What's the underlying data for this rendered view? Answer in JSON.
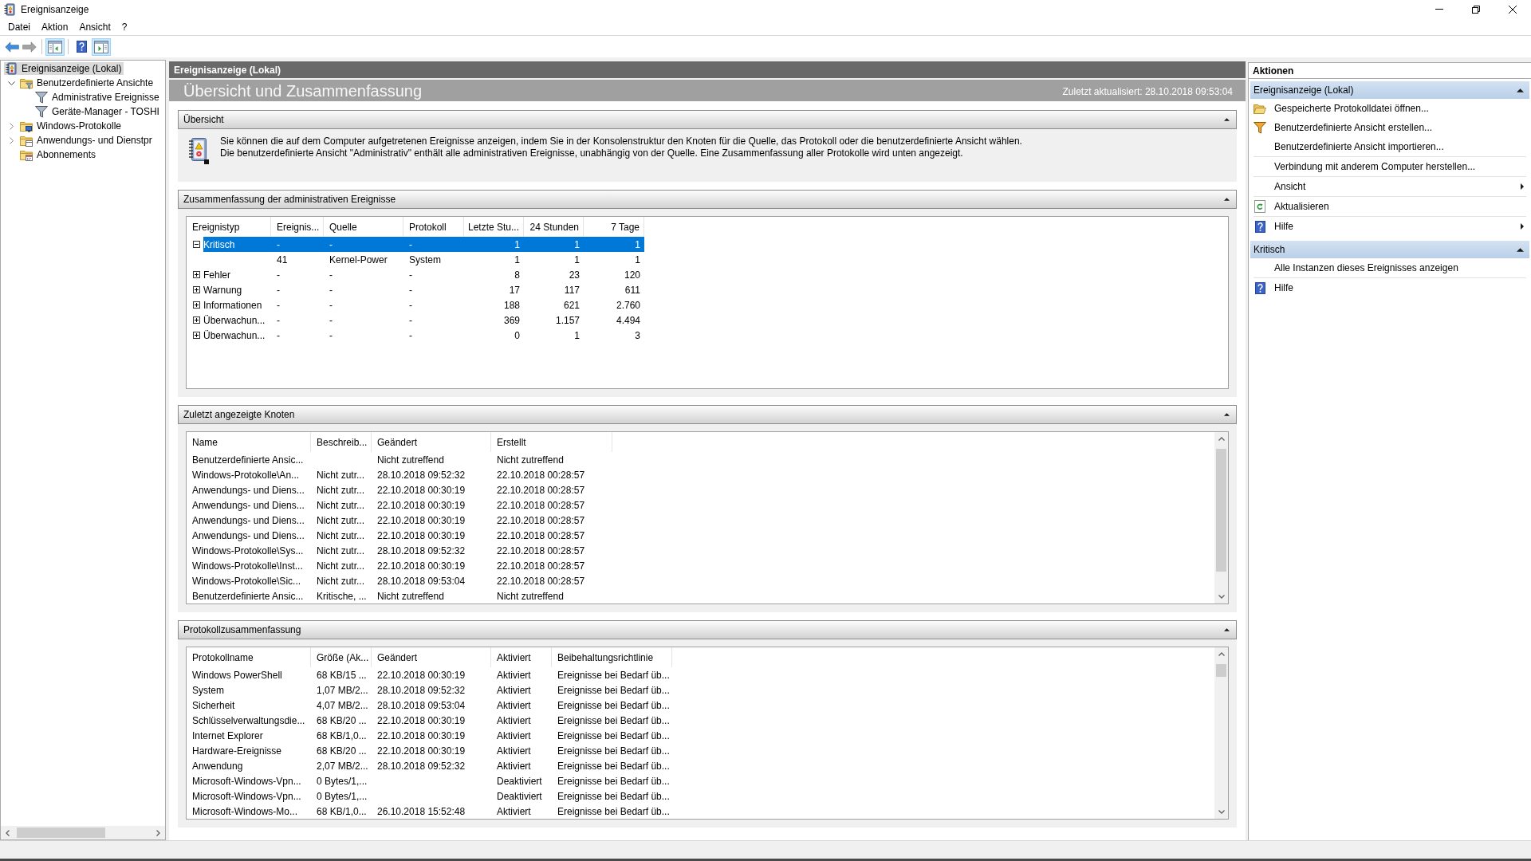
{
  "window": {
    "title": "Ereignisanzeige"
  },
  "menu": [
    "Datei",
    "Aktion",
    "Ansicht",
    "?"
  ],
  "toolbar": [
    {
      "kind": "back",
      "disabled": false
    },
    {
      "kind": "forward",
      "disabled": true
    },
    {
      "kind": "separator"
    },
    {
      "kind": "console_tree",
      "on": true
    },
    {
      "kind": "separator"
    },
    {
      "kind": "help"
    },
    {
      "kind": "action_pane",
      "on": true
    }
  ],
  "tree": [
    {
      "label": "Ereignisanzeige (Lokal)",
      "kind": "viewer",
      "selected": true,
      "children": [
        {
          "label": "Benutzerdefinierte Ansichte",
          "kind": "filter_folder",
          "selected": false,
          "expanded": true,
          "children": [
            {
              "label": "Administrative Ereignisse",
              "kind": "filter",
              "selected": false
            },
            {
              "label": "Geräte-Manager - TOSHI",
              "kind": "filter",
              "selected": false
            }
          ]
        },
        {
          "label": "Windows-Protokolle",
          "kind": "log_folder",
          "selected": false,
          "expanded": false
        },
        {
          "label": "Anwendungs- und Dienstpr",
          "kind": "app_folder",
          "selected": false,
          "expanded": false
        },
        {
          "label": "Abonnements",
          "kind": "subscription_folder",
          "selected": false
        }
      ]
    }
  ],
  "center": {
    "header": "Ereignisanzeige (Lokal)",
    "title": "Übersicht und Zusammenfassung",
    "updated": "Zuletzt aktualisiert: 28.10.2018 09:53:04",
    "sections": [
      {
        "kind": "text",
        "title": "Übersicht",
        "expanded": true,
        "text": "Sie können die auf dem Computer aufgetretenen Ereignisse anzeigen, indem Sie in der Konsolenstruktur den Knoten für die Quelle, das Protokoll oder die benutzerdefinierte Ansicht wählen. Die benutzerdefinierte Ansicht \"Administrativ\" enthält alle administrativen Ereignisse, unabhängig von der Quelle. Eine Zusammenfassung aller Protokolle wird unten angezeigt."
      },
      {
        "kind": "table",
        "title": "Zusammenfassung der administrativen Ereignisse",
        "expanded": true,
        "columns": [
          "Ereignistyp",
          "Ereignis...",
          "Quelle",
          "Protokoll",
          "Letzte Stu...",
          "24 Stunden",
          "7 Tage"
        ],
        "rows": [
          {
            "type": "Kritisch",
            "event_id": "-",
            "source": "-",
            "log": "-",
            "last_hour": "1",
            "last_24_hours": "1",
            "last_7_days": "1",
            "expanded": true,
            "selected": true,
            "children": [
              {
                "event_id": "41",
                "source": "Kernel-Power",
                "log": "System",
                "last_hour": "1",
                "last_24_hours": "1",
                "last_7_days": "1",
                "selected": false
              }
            ]
          },
          {
            "type": "Fehler",
            "event_id": "-",
            "source": "-",
            "log": "-",
            "last_hour": "8",
            "last_24_hours": "23",
            "last_7_days": "120",
            "expanded": false,
            "selected": false
          },
          {
            "type": "Warnung",
            "event_id": "-",
            "source": "-",
            "log": "-",
            "last_hour": "17",
            "last_24_hours": "117",
            "last_7_days": "611",
            "expanded": false,
            "selected": false
          },
          {
            "type": "Informationen",
            "event_id": "-",
            "source": "-",
            "log": "-",
            "last_hour": "188",
            "last_24_hours": "621",
            "last_7_days": "2.760",
            "expanded": false,
            "selected": false
          },
          {
            "type": "Überwachun...",
            "event_id": "-",
            "source": "-",
            "log": "-",
            "last_hour": "369",
            "last_24_hours": "1.157",
            "last_7_days": "4.494",
            "expanded": false,
            "selected": false
          },
          {
            "type": "Überwachun...",
            "event_id": "-",
            "source": "-",
            "log": "-",
            "last_hour": "0",
            "last_24_hours": "1",
            "last_7_days": "3",
            "expanded": false,
            "selected": false
          }
        ]
      },
      {
        "kind": "table",
        "title": "Zuletzt angezeigte Knoten",
        "expanded": true,
        "columns": [
          "Name",
          "Beschreib...",
          "Geändert",
          "Erstellt"
        ],
        "rows": [
          {
            "name": "Benutzerdefinierte Ansic...",
            "modified": "Nicht zutreffend",
            "created": "Nicht zutreffend"
          },
          {
            "name": "Windows-Protokolle\\An...",
            "description": "Nicht zutr...",
            "modified": "28.10.2018 09:52:32",
            "created": "22.10.2018 00:28:57"
          },
          {
            "name": "Anwendungs- und Diens...",
            "description": "Nicht zutr...",
            "modified": "22.10.2018 00:30:19",
            "created": "22.10.2018 00:28:57"
          },
          {
            "name": "Anwendungs- und Diens...",
            "description": "Nicht zutr...",
            "modified": "22.10.2018 00:30:19",
            "created": "22.10.2018 00:28:57"
          },
          {
            "name": "Anwendungs- und Diens...",
            "description": "Nicht zutr...",
            "modified": "22.10.2018 00:30:19",
            "created": "22.10.2018 00:28:57"
          },
          {
            "name": "Anwendungs- und Diens...",
            "description": "Nicht zutr...",
            "modified": "22.10.2018 00:30:19",
            "created": "22.10.2018 00:28:57"
          },
          {
            "name": "Windows-Protokolle\\Sys...",
            "description": "Nicht zutr...",
            "modified": "28.10.2018 09:52:32",
            "created": "22.10.2018 00:28:57"
          },
          {
            "name": "Windows-Protokolle\\Inst...",
            "description": "Nicht zutr...",
            "modified": "22.10.2018 00:30:19",
            "created": "22.10.2018 00:28:57"
          },
          {
            "name": "Windows-Protokolle\\Sic...",
            "description": "Nicht zutr...",
            "modified": "28.10.2018 09:53:04",
            "created": "22.10.2018 00:28:57"
          },
          {
            "name": "Benutzerdefinierte Ansic...",
            "description": "Kritische, ...",
            "modified": "Nicht zutreffend",
            "created": "Nicht zutreffend"
          }
        ]
      },
      {
        "kind": "table",
        "title": "Protokollzusammenfassung",
        "expanded": true,
        "columns": [
          "Protokollname",
          "Größe (Ak...",
          "Geändert",
          "Aktiviert",
          "Beibehaltungsrichtlinie"
        ],
        "rows": [
          {
            "name": "Windows PowerShell",
            "size": "68 KB/15 ...",
            "modified": "22.10.2018 00:30:19",
            "enabled": "Aktiviert",
            "retention": "Ereignisse bei Bedarf üb..."
          },
          {
            "name": "System",
            "size": "1,07 MB/2...",
            "modified": "28.10.2018 09:52:32",
            "enabled": "Aktiviert",
            "retention": "Ereignisse bei Bedarf üb..."
          },
          {
            "name": "Sicherheit",
            "size": "4,07 MB/2...",
            "modified": "28.10.2018 09:53:04",
            "enabled": "Aktiviert",
            "retention": "Ereignisse bei Bedarf üb..."
          },
          {
            "name": "Schlüsselverwaltungsdie...",
            "size": "68 KB/20 ...",
            "modified": "22.10.2018 00:30:19",
            "enabled": "Aktiviert",
            "retention": "Ereignisse bei Bedarf üb..."
          },
          {
            "name": "Internet Explorer",
            "size": "68 KB/1,0...",
            "modified": "22.10.2018 00:30:19",
            "enabled": "Aktiviert",
            "retention": "Ereignisse bei Bedarf üb..."
          },
          {
            "name": "Hardware-Ereignisse",
            "size": "68 KB/20 ...",
            "modified": "22.10.2018 00:30:19",
            "enabled": "Aktiviert",
            "retention": "Ereignisse bei Bedarf üb..."
          },
          {
            "name": "Anwendung",
            "size": "2,07 MB/2...",
            "modified": "28.10.2018 09:52:32",
            "enabled": "Aktiviert",
            "retention": "Ereignisse bei Bedarf üb..."
          },
          {
            "name": "Microsoft-Windows-Vpn...",
            "size": "0 Bytes/1,...",
            "enabled": "Deaktiviert",
            "retention": "Ereignisse bei Bedarf üb..."
          },
          {
            "name": "Microsoft-Windows-Vpn...",
            "size": "0 Bytes/1,...",
            "enabled": "Deaktiviert",
            "retention": "Ereignisse bei Bedarf üb..."
          },
          {
            "name": "Microsoft-Windows-Mo...",
            "size": "68 KB/1,0...",
            "modified": "26.10.2018 15:52:48",
            "enabled": "Aktiviert",
            "retention": "Ereignisse bei Bedarf üb..."
          }
        ]
      }
    ]
  },
  "actions": {
    "title": "Aktionen",
    "sections": [
      {
        "title": "Ereignisanzeige (Lokal)",
        "expanded": true,
        "items": [
          {
            "label": "Gespeicherte Protokolldatei öffnen...",
            "kind": "open",
            "submenu": false,
            "divider": false
          },
          {
            "label": "Benutzerdefinierte Ansicht erstellen...",
            "kind": "filter",
            "submenu": false,
            "divider": false
          },
          {
            "label": "Benutzerdefinierte Ansicht importieren...",
            "kind": "plain",
            "submenu": false,
            "divider": false
          },
          {
            "label": "Verbindung mit anderem Computer herstellen...",
            "kind": "plain",
            "submenu": false,
            "divider": true
          },
          {
            "label": "Ansicht",
            "kind": "plain",
            "submenu": true,
            "divider": true
          },
          {
            "label": "Aktualisieren",
            "kind": "refresh",
            "submenu": false,
            "divider": true
          },
          {
            "label": "Hilfe",
            "kind": "help",
            "submenu": true,
            "divider": true
          }
        ]
      },
      {
        "title": "Kritisch",
        "expanded": true,
        "items": [
          {
            "label": "Alle Instanzen dieses Ereignisses anzeigen",
            "kind": "plain",
            "submenu": false,
            "divider": false
          },
          {
            "label": "Hilfe",
            "kind": "help",
            "submenu": false,
            "divider": true
          }
        ]
      }
    ]
  }
}
